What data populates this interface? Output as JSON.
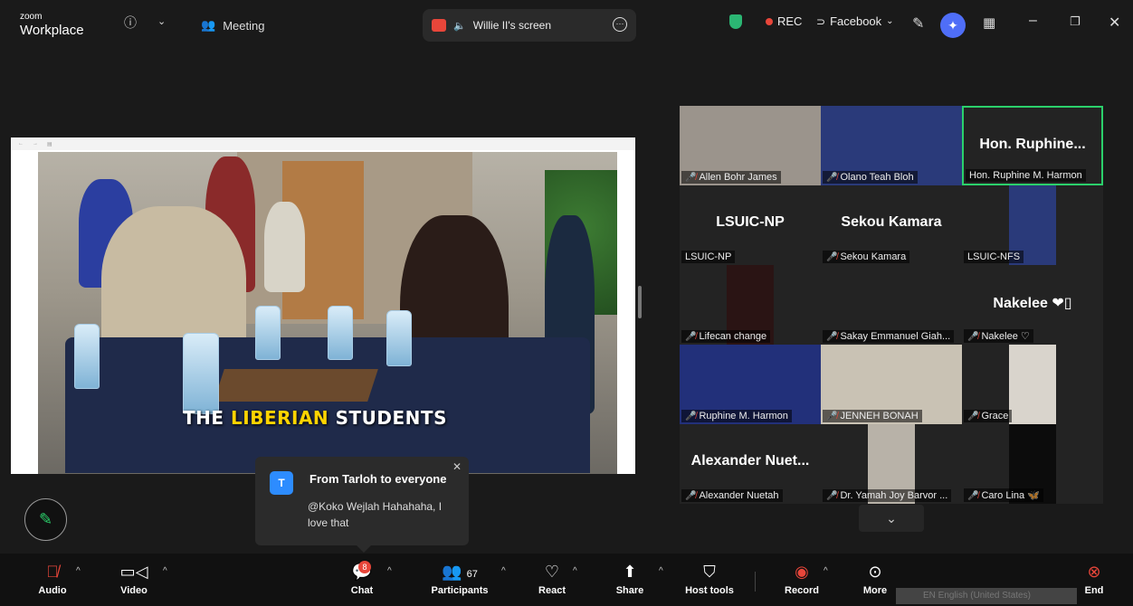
{
  "titlebar": {
    "logo_top": "zoom",
    "logo_bottom": "Workplace",
    "meeting_label": "Meeting",
    "share_label": "Willie II's screen",
    "rec_label": "REC",
    "stream_label": "Facebook"
  },
  "shared_screen": {
    "caption_prefix": "THE ",
    "caption_highlight": "LIBERIAN",
    "caption_suffix": " STUDENTS"
  },
  "gallery": {
    "tiles": [
      {
        "name": "Allen Bohr James",
        "big": ""
      },
      {
        "name": "Olano Teah Bloh",
        "big": ""
      },
      {
        "name": "Hon. Ruphine M. Harmon",
        "big": "Hon. Ruphine..."
      },
      {
        "name": "LSUIC-NP",
        "big": "LSUIC-NP"
      },
      {
        "name": "Sekou Kamara",
        "big": "Sekou Kamara"
      },
      {
        "name": "LSUIC-NFS",
        "big": ""
      },
      {
        "name": "Lifecan change",
        "big": ""
      },
      {
        "name": "Sakay Emmanuel Giah...",
        "big": ""
      },
      {
        "name": "Nakelee ♡",
        "big": "Nakelee ❤▯"
      },
      {
        "name": "Ruphine M. Harmon",
        "big": ""
      },
      {
        "name": "JENNEH BONAH",
        "big": ""
      },
      {
        "name": "Grace",
        "big": ""
      },
      {
        "name": "Alexander Nuetah",
        "big": "Alexander Nuet..."
      },
      {
        "name": "Dr. Yamah Joy Barvor ...",
        "big": ""
      },
      {
        "name": "Caro Lina 🦋",
        "big": ""
      }
    ]
  },
  "chat": {
    "avatar_letter": "T",
    "from": "From Tarloh to everyone",
    "message": "@Koko Wejlah Hahahaha, I love that"
  },
  "toolbar": {
    "audio": "Audio",
    "video": "Video",
    "chat": "Chat",
    "chat_badge": "8",
    "participants": "Participants",
    "participants_count": "67",
    "react": "React",
    "share": "Share",
    "host_tools": "Host tools",
    "record": "Record",
    "more": "More",
    "end": "End",
    "language": "EN English (United States)"
  }
}
